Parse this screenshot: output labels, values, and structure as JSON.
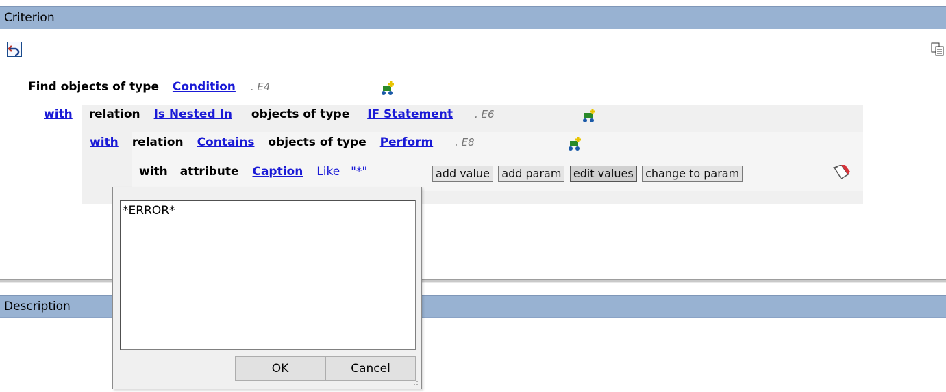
{
  "criterion_panel": {
    "title": "Criterion"
  },
  "description_panel": {
    "title": "Description"
  },
  "toolbar": {
    "undo_icon": "undo-icon",
    "copy_icon": "copy-icon"
  },
  "query": {
    "line1": {
      "prefix": "Find objects of type",
      "type_link": "Condition",
      "elabel": ". E4"
    },
    "line2": {
      "with": "with",
      "relation_label": "relation",
      "relation_link": "Is Nested In",
      "objects_label": "objects of type",
      "type_link": "IF Statement",
      "elabel": ". E6"
    },
    "line3": {
      "with": "with",
      "relation_label": "relation",
      "relation_link": "Contains",
      "objects_label": "objects of type",
      "type_link": "Perform",
      "elabel": ". E8"
    },
    "line4": {
      "with": "with",
      "attribute_label": "attribute",
      "attribute_link": "Caption",
      "operator": "Like",
      "value": "\"*\""
    }
  },
  "attr_buttons": {
    "add_value": "add value",
    "add_param": "add param",
    "edit_values": "edit values",
    "change_to_param": "change to param"
  },
  "dialog": {
    "text": "*ERROR*",
    "ok": "OK",
    "cancel": "Cancel"
  },
  "colors": {
    "header_bg": "#98b2d2",
    "link": "#1a1ad6"
  }
}
